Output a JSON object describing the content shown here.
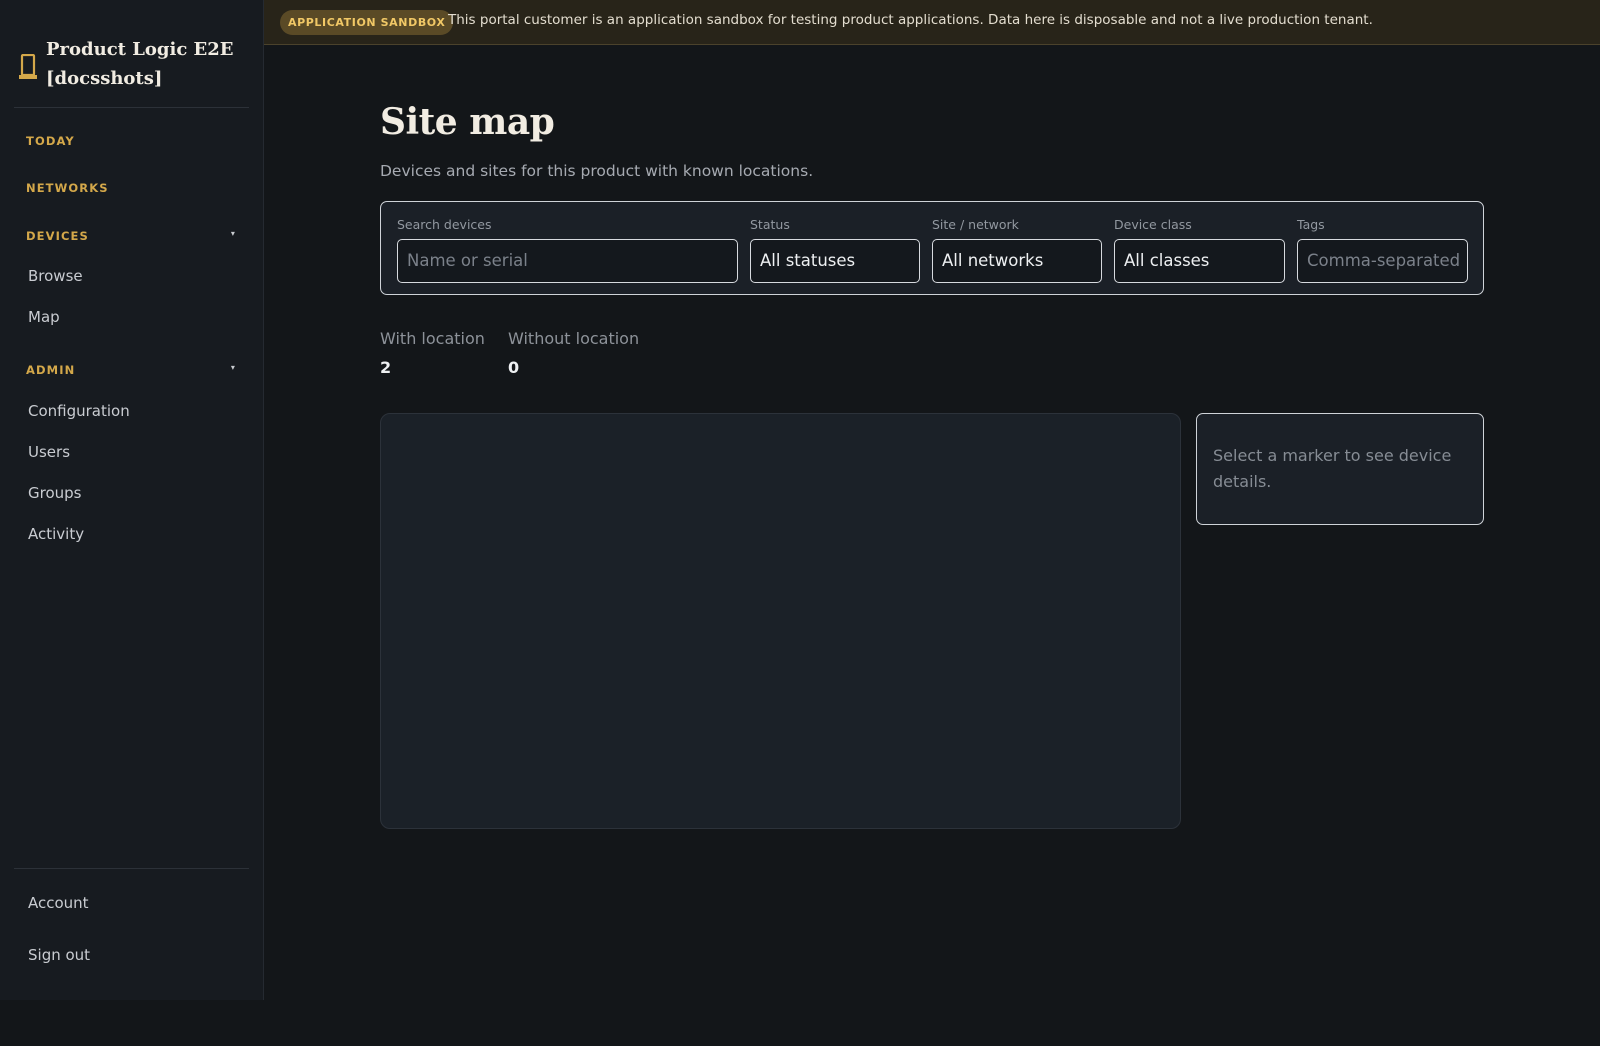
{
  "sidebar": {
    "brand": {
      "icon": "tower-icon",
      "name": "Product Logic E2E [docsshots]"
    },
    "sections": {
      "today": "TODAY",
      "networks": "NETWORKS",
      "devices": {
        "label": "DEVICES",
        "caret": "▾",
        "items": [
          "Browse",
          "Map"
        ]
      },
      "admin": {
        "label": "ADMIN",
        "caret": "▾",
        "items": [
          "Configuration",
          "Users",
          "Groups",
          "Activity"
        ]
      }
    },
    "footer": {
      "account": "Account",
      "sign_out": "Sign out"
    }
  },
  "banner": {
    "badge": "APPLICATION SANDBOX",
    "text": "This portal customer is an application sandbox for testing product applications. Data here is disposable and not a live production tenant."
  },
  "main": {
    "title": "Site map",
    "subtitle": "Devices and sites for this product with known locations.",
    "filters": {
      "search": {
        "label": "Search devices",
        "placeholder": "Name or serial"
      },
      "status": {
        "label": "Status",
        "value": "All statuses"
      },
      "site": {
        "label": "Site / network",
        "value": "All networks"
      },
      "device_class": {
        "label": "Device class",
        "value": "All classes"
      },
      "tags": {
        "label": "Tags",
        "placeholder": "Comma-separated"
      }
    },
    "stats": {
      "with_location": {
        "label": "With location",
        "value": "2"
      },
      "without_location": {
        "label": "Without location",
        "value": "0"
      }
    },
    "details_placeholder": "Select a marker to see device details."
  },
  "colors": {
    "accent": "#d4a84a",
    "background": "#131619",
    "sidebar": "#171b20",
    "banner": "#282419"
  }
}
